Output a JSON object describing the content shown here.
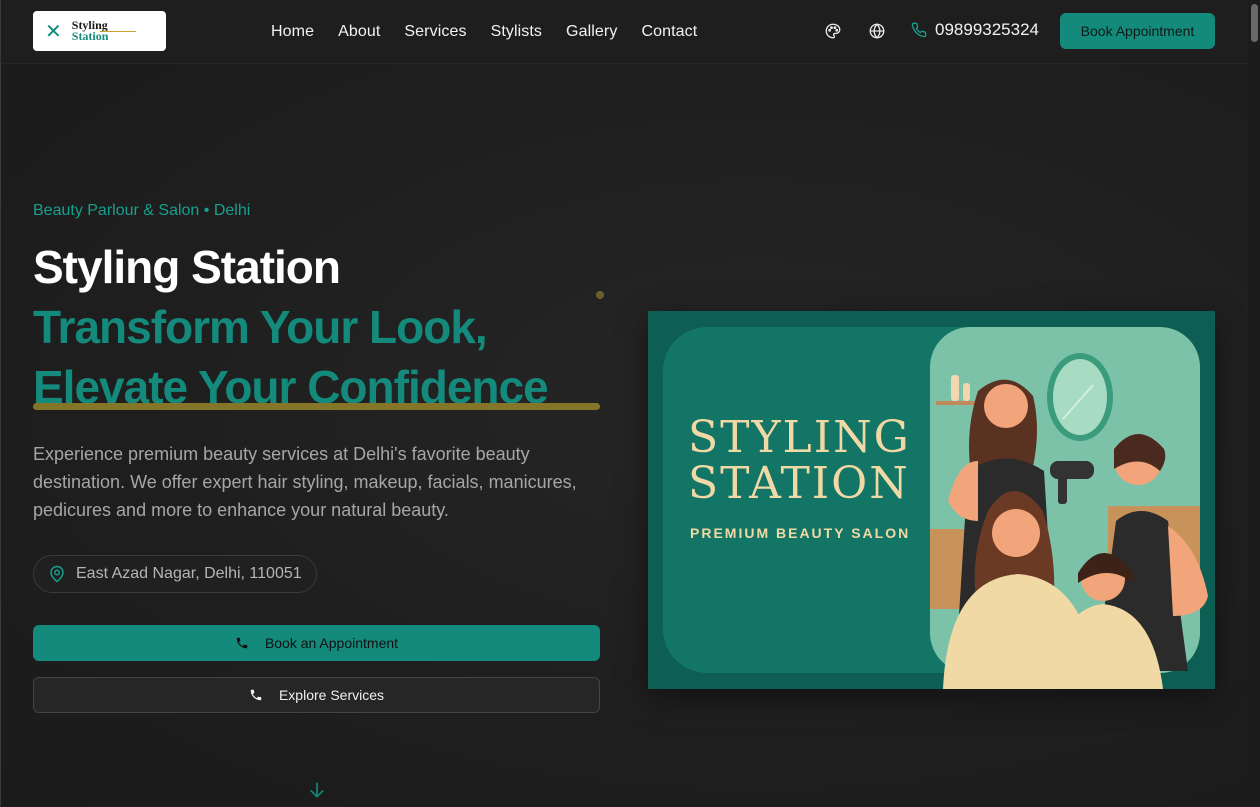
{
  "brand": {
    "logo_line1": "Styling",
    "logo_line2": "Station"
  },
  "nav": {
    "items": [
      {
        "label": "Home"
      },
      {
        "label": "About"
      },
      {
        "label": "Services"
      },
      {
        "label": "Stylists"
      },
      {
        "label": "Gallery"
      },
      {
        "label": "Contact"
      }
    ]
  },
  "header": {
    "phone": "09899325324",
    "book_label": "Book Appointment"
  },
  "hero": {
    "eyebrow": "Beauty Parlour & Salon • Delhi",
    "title": "Styling Station",
    "tagline_line1": "Transform Your Look,",
    "tagline_line2": "Elevate Your Confidence",
    "description": "Experience premium beauty services at Delhi's favorite beauty destination. We offer expert hair styling, makeup, facials, manicures, pedicures and more to enhance your natural beauty.",
    "address": "East Azad Nagar, Delhi, 110051",
    "primary_button": "Book an Appointment",
    "secondary_button": "Explore Services"
  },
  "hero_image": {
    "title_line1": "STYLING",
    "title_line2": "STATION",
    "subtitle": "PREMIUM BEAUTY SALON"
  },
  "colors": {
    "accent": "#138a7c",
    "background": "#1f1f1f",
    "underline": "#8a7a2a",
    "cream": "#f1d9a6"
  },
  "icons": {
    "theme": "palette-icon",
    "language": "globe-icon",
    "phone": "phone-icon",
    "location": "map-pin-icon",
    "scroll": "arrow-down-icon"
  }
}
